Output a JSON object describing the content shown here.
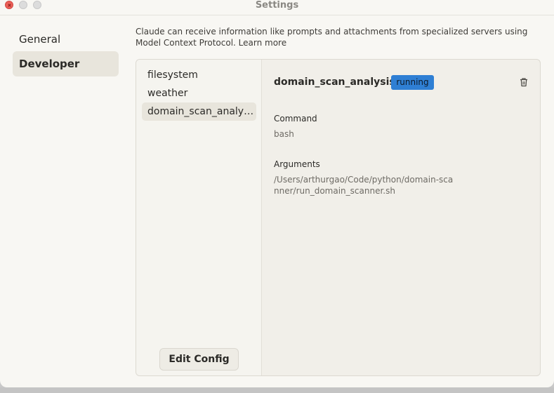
{
  "window": {
    "title": "Settings"
  },
  "sidebar": {
    "items": [
      {
        "label": "General",
        "selected": false
      },
      {
        "label": "Developer",
        "selected": true
      }
    ]
  },
  "description": "Claude can receive information like prompts and attachments from specialized servers using Model Context Protocol. Learn more",
  "servers": {
    "items": [
      {
        "label": "filesystem",
        "selected": false
      },
      {
        "label": "weather",
        "selected": false
      },
      {
        "label": "domain_scan_analysis",
        "selected": true
      }
    ],
    "edit_config_label": "Edit Config"
  },
  "detail": {
    "name": "domain_scan_analysis",
    "status": "running",
    "status_color": "#2f7fd4",
    "command_label": "Command",
    "command_value": "bash",
    "arguments_label": "Arguments",
    "arguments_value": "/Users/arthurgao/Code/python/domain-scanner/run_domain_scanner.sh",
    "delete_icon": "trash-icon"
  }
}
